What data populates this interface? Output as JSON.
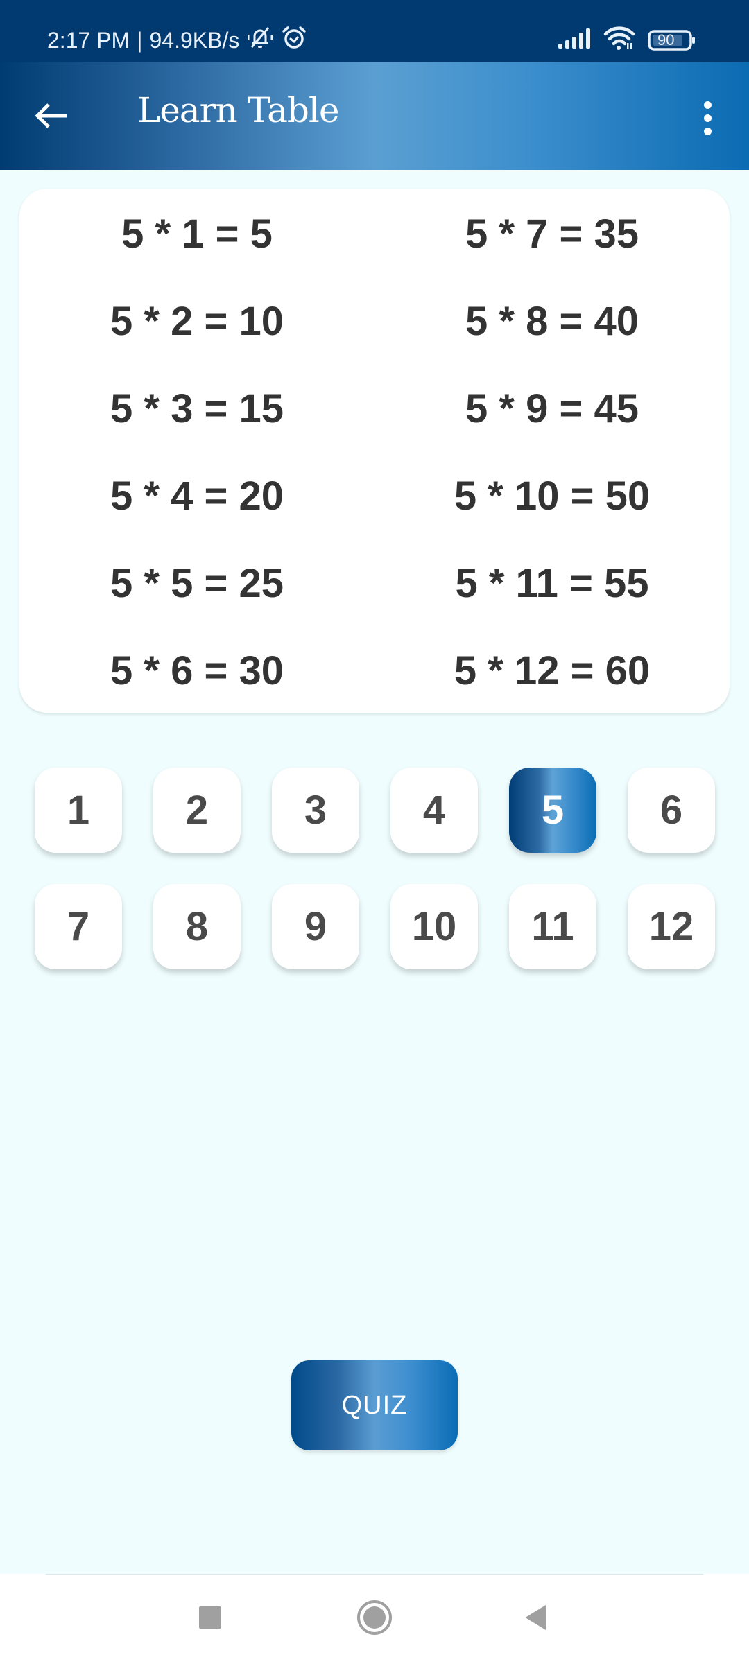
{
  "status_bar": {
    "time": "2:17 PM",
    "separator": "|",
    "network_speed": "94.9KB/s",
    "icons": [
      "vibrate-off-icon",
      "alarm-icon",
      "signal-icon",
      "wifi-icon",
      "battery-icon"
    ],
    "battery_level": "90"
  },
  "app_bar": {
    "title": "Learn Table",
    "back_icon": "arrow-left-icon",
    "menu_icon": "more-vert-icon"
  },
  "table": {
    "selected_number": 5,
    "left_column": [
      "5 * 1 = 5",
      "5 * 2 = 10",
      "5 * 3 = 15",
      "5 * 4 = 20",
      "5 * 5 = 25",
      "5 * 6 = 30"
    ],
    "right_column": [
      "5 * 7 = 35",
      "5 * 8 = 40",
      "5 * 9 = 45",
      "5 * 10 = 50",
      "5 * 11 = 55",
      "5 * 12 = 60"
    ]
  },
  "number_selector": {
    "options": [
      "1",
      "2",
      "3",
      "4",
      "5",
      "6",
      "7",
      "8",
      "9",
      "10",
      "11",
      "12"
    ],
    "selected": "5"
  },
  "quiz_button": {
    "label": "QUIZ"
  },
  "nav_bar": {
    "recents": "recents-square-icon",
    "home": "home-circle-icon",
    "back": "back-triangle-icon"
  },
  "colors": {
    "status_bar": "#003a70",
    "accent_dark": "#003b71",
    "accent_light": "#5b9fd2",
    "accent_end": "#0b6bb2",
    "background": "#effdfe",
    "table_text": "#333333",
    "button_text": "#4a4a4a"
  }
}
